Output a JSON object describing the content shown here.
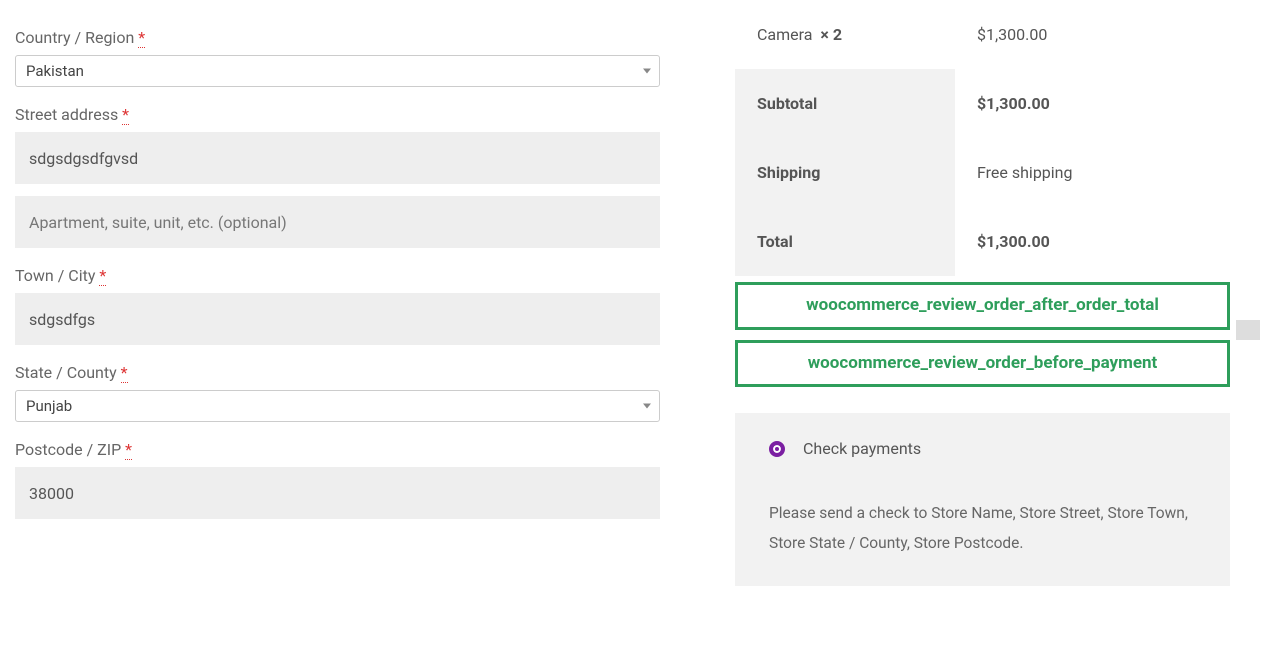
{
  "billing": {
    "country_label": "Country / Region",
    "country_value": "Pakistan",
    "street_label": "Street address",
    "street_value": "sdgsdgsdfgvsd",
    "street2_placeholder": "Apartment, suite, unit, etc. (optional)",
    "city_label": "Town / City",
    "city_value": "sdgsdfgs",
    "state_label": "State / County",
    "state_value": "Punjab",
    "postcode_label": "Postcode / ZIP",
    "postcode_value": "38000"
  },
  "order": {
    "product_name": "Camera",
    "product_qty": "× 2",
    "product_total": "$1,300.00",
    "subtotal_label": "Subtotal",
    "subtotal_value": "$1,300.00",
    "shipping_label": "Shipping",
    "shipping_value": "Free shipping",
    "total_label": "Total",
    "total_value": "$1,300.00"
  },
  "hooks": {
    "after_total": "woocommerce_review_order_after_order_total",
    "before_payment": "woocommerce_review_order_before_payment"
  },
  "payment": {
    "method_label": "Check payments",
    "description": "Please send a check to Store Name, Store Street, Store Town, Store State / County, Store Postcode."
  },
  "required_mark": "*"
}
